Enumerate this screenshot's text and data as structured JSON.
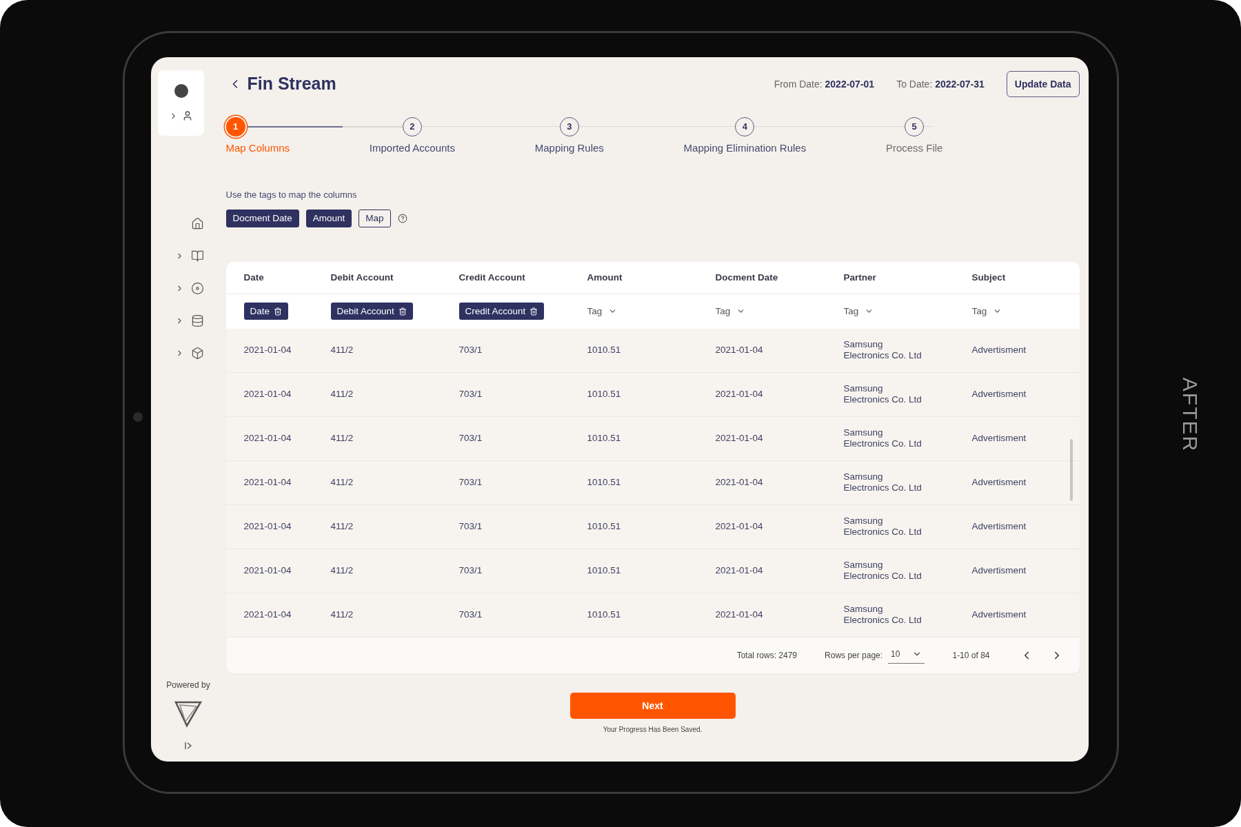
{
  "side_label": "AFTER",
  "sidebar": {
    "nav_items": [
      {
        "kind": "plain"
      },
      {
        "kind": "expandable"
      },
      {
        "kind": "expandable"
      },
      {
        "kind": "expandable"
      },
      {
        "kind": "expandable"
      }
    ],
    "powered_by": "Powered by"
  },
  "header": {
    "title": "Fin Stream",
    "from_label": "From Date:",
    "from_value": "2022-07-01",
    "to_label": "To Date:",
    "to_value": "2022-07-31",
    "update_button": "Update Data"
  },
  "steps": [
    {
      "number": "1",
      "label": "Map Columns",
      "selected": true,
      "disabled": false
    },
    {
      "number": "2",
      "label": "Imported Accounts",
      "selected": false,
      "disabled": false
    },
    {
      "number": "3",
      "label": "Mapping Rules",
      "selected": false,
      "disabled": false
    },
    {
      "number": "4",
      "label": "Mapping Elimination Rules",
      "selected": false,
      "disabled": false
    },
    {
      "number": "5",
      "label": "Process File",
      "selected": false,
      "disabled": true
    }
  ],
  "step_progress": {
    "level": 0.6
  },
  "hint": "Use the tags to map the columns",
  "tags": [
    {
      "kind": "filled",
      "label": "Docment Date"
    },
    {
      "kind": "filled",
      "label": "Amount"
    },
    {
      "kind": "outlined",
      "label": "Map"
    }
  ],
  "table": {
    "columns": [
      {
        "header": "Date",
        "mapping": {
          "kind": "chip",
          "label": "Date"
        }
      },
      {
        "header": "Debit Account",
        "mapping": {
          "kind": "chip",
          "label": "Debit Account"
        }
      },
      {
        "header": "Credit Account",
        "mapping": {
          "kind": "chip",
          "label": "Credit Account"
        }
      },
      {
        "header": "Amount",
        "mapping": {
          "kind": "select",
          "label": "Tag"
        }
      },
      {
        "header": "Docment Date",
        "mapping": {
          "kind": "select",
          "label": "Tag"
        }
      },
      {
        "header": "Partner",
        "mapping": {
          "kind": "select",
          "label": "Tag"
        }
      },
      {
        "header": "Subject",
        "mapping": {
          "kind": "select",
          "label": "Tag"
        }
      }
    ],
    "rows": [
      [
        "2021-01-04",
        "411/2",
        "703/1",
        "1010.51",
        "2021-01-04",
        "Samsung Electronics Co. Ltd",
        "Advertisment"
      ],
      [
        "2021-01-04",
        "411/2",
        "703/1",
        "1010.51",
        "2021-01-04",
        "Samsung Electronics Co. Ltd",
        "Advertisment"
      ],
      [
        "2021-01-04",
        "411/2",
        "703/1",
        "1010.51",
        "2021-01-04",
        "Samsung Electronics Co. Ltd",
        "Advertisment"
      ],
      [
        "2021-01-04",
        "411/2",
        "703/1",
        "1010.51",
        "2021-01-04",
        "Samsung Electronics Co. Ltd",
        "Advertisment"
      ],
      [
        "2021-01-04",
        "411/2",
        "703/1",
        "1010.51",
        "2021-01-04",
        "Samsung Electronics Co. Ltd",
        "Advertisment"
      ],
      [
        "2021-01-04",
        "411/2",
        "703/1",
        "1010.51",
        "2021-01-04",
        "Samsung Electronics Co. Ltd",
        "Advertisment"
      ],
      [
        "2021-01-04",
        "411/2",
        "703/1",
        "1010.51",
        "2021-01-04",
        "Samsung Electronics Co. Ltd",
        "Advertisment"
      ]
    ],
    "footer": {
      "total_rows": "Total rows: 2479",
      "rows_per_page_label": "Rows per page:",
      "rows_per_page": "10",
      "range": "1-10 of 84"
    }
  },
  "next_button": "Next",
  "saved_note": "Your Progress Has Been Saved."
}
